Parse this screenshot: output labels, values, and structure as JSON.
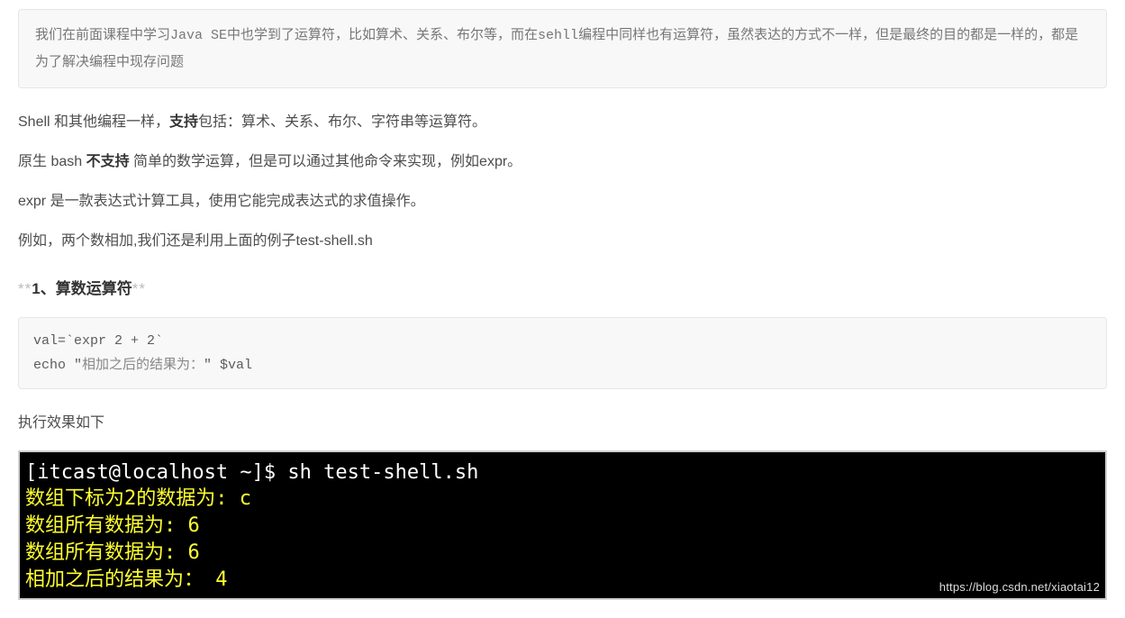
{
  "blockquote": {
    "pre1": "我们在前面课程中学习",
    "mono1": "Java SE",
    "mid1": "中也学到了运算符，比如算术、关系、布尔等，而在",
    "mono2": "sehll",
    "post1": "编程中同样也有运算符，虽然表达的方式不一样，但是最终的目的都是一样的，都是为了解决编程中现存问题"
  },
  "p1": {
    "pre": "Shell 和其他编程一样，",
    "strong": "支持",
    "post": "包括：算术、关系、布尔、字符串等运算符。"
  },
  "p2": {
    "pre": "原生 bash ",
    "strong": "不支持",
    "post": " 简单的数学运算，但是可以通过其他命令来实现，例如expr。"
  },
  "p3": {
    "text": "expr 是一款表达式计算工具，使用它能完成表达式的求值操作。"
  },
  "p4": {
    "text": "例如，两个数相加,我们还是利用上面的例子test-shell.sh"
  },
  "heading1": {
    "asters_l": "**",
    "text": "1、算数运算符",
    "asters_r": "**"
  },
  "code1": {
    "line1": "val=`expr 2 + 2`",
    "line2a": "echo \"",
    "line2b": "相加之后的结果为：",
    "line2c": "\" $val"
  },
  "p5": {
    "text": "执行效果如下"
  },
  "terminal": {
    "prompt": "[itcast@localhost ~]$ ",
    "cmd": "sh test-shell.sh",
    "l2": "数组下标为2的数据为: c",
    "l3": "数组所有数据为: 6",
    "l4": "数组所有数据为: 6",
    "l5": "相加之后的结果为：  4"
  },
  "watermark": "https://blog.csdn.net/xiaotai12"
}
